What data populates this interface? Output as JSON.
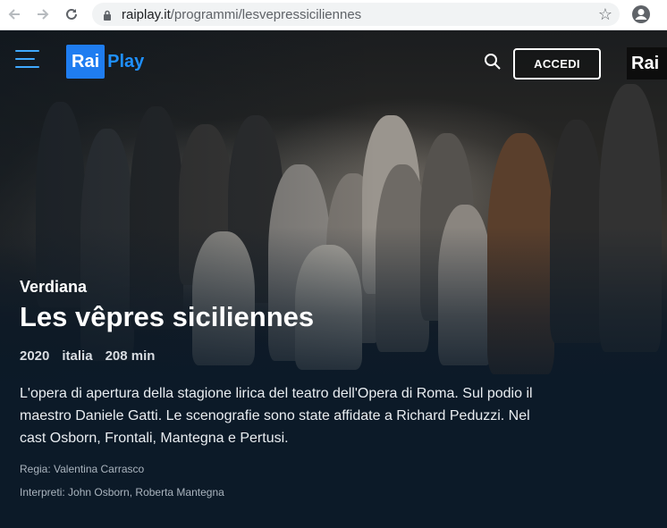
{
  "browser": {
    "url_domain": "raiplay.it",
    "url_path": "/programmi/lesvepressiciliennes"
  },
  "header": {
    "logo_rai": "Rai",
    "logo_play": "Play",
    "login_label": "ACCEDI",
    "corner_logo": "Rai"
  },
  "program": {
    "brand": "Verdiana",
    "title": "Les vêpres siciliennes",
    "year": "2020",
    "country": "italia",
    "duration": "208 min",
    "description": "L'opera di apertura della stagione lirica del teatro dell'Opera di Roma. Sul podio il maestro Daniele Gatti. Le scenografie sono state affidate a Richard Peduzzi. Nel cast Osborn, Frontali, Mantegna e Pertusi.",
    "director": "Regia: Valentina Carrasco",
    "cast": "Interpreti: John Osborn, Roberta Mantegna"
  },
  "colors": {
    "accent": "#1f7df0",
    "background": "#0c1a28"
  }
}
